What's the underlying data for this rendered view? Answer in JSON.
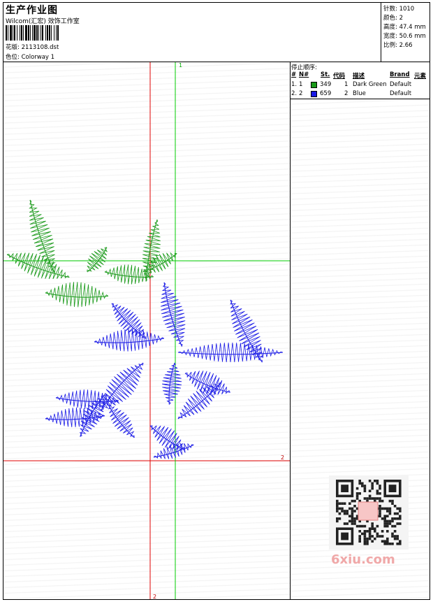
{
  "header": {
    "title": "生产作业图",
    "company": "Wilcom(汇宏) 效饰工作室",
    "design_label": "花版:",
    "design_file": "2113108.dst",
    "colorway_label": "色位:",
    "colorway": "Colorway 1"
  },
  "stats": {
    "stitches_label": "针数:",
    "stitches": "1010",
    "colors_label": "颜色:",
    "colors": "2",
    "height_label": "高度:",
    "height": "47.4 mm",
    "width_label": "宽度:",
    "width": "50.6 mm",
    "scale_label": "比例:",
    "scale": "2.66"
  },
  "stop_sequence": {
    "title": "停止顺序:",
    "headers": [
      "#",
      "N#",
      "St.",
      "代码",
      "描述",
      "Brand",
      "元素"
    ],
    "rows": [
      {
        "idx": "1.",
        "n": "1",
        "color": "#1b9a1b",
        "code": "349",
        "code_num": "1",
        "desc": "Dark Green",
        "brand": "Default"
      },
      {
        "idx": "2.",
        "n": "2",
        "color": "#1a1ae6",
        "code": "659",
        "code_num": "2",
        "desc": "Blue",
        "brand": "Default"
      }
    ]
  },
  "guides": {
    "green_v_label": "1",
    "red_h_label": "2",
    "red_v_label": "2"
  },
  "colors": {
    "green": "#1b9a1b",
    "blue": "#1a1ae6",
    "red_guide": "#e00000",
    "green_guide": "#00cc00"
  },
  "watermark": {
    "text": "6xiu.com",
    "qr_icon": "qr-code-icon"
  }
}
